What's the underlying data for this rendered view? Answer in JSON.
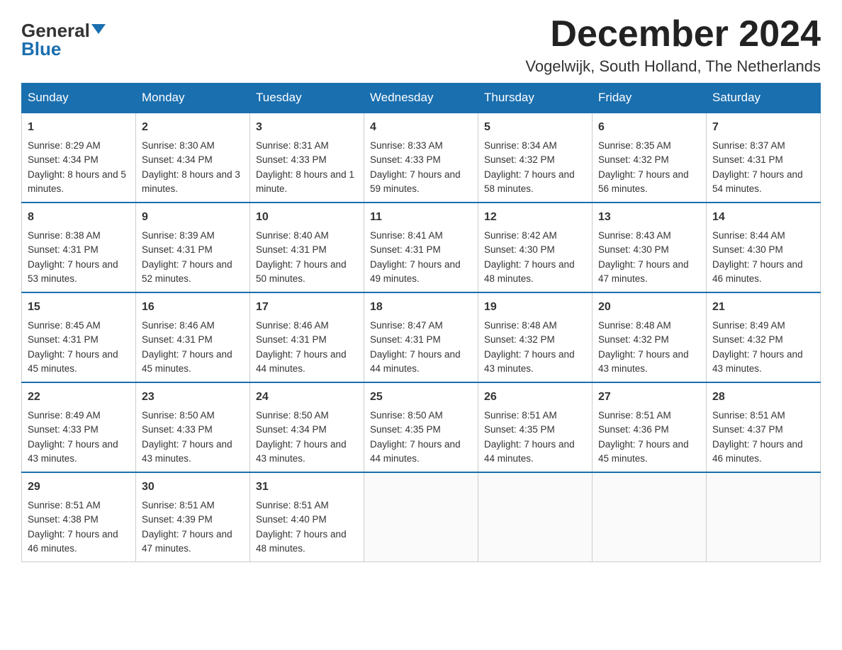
{
  "logo": {
    "general": "General",
    "blue": "Blue"
  },
  "header": {
    "month": "December 2024",
    "location": "Vogelwijk, South Holland, The Netherlands"
  },
  "weekdays": [
    "Sunday",
    "Monday",
    "Tuesday",
    "Wednesday",
    "Thursday",
    "Friday",
    "Saturday"
  ],
  "weeks": [
    [
      {
        "day": "1",
        "sunrise": "Sunrise: 8:29 AM",
        "sunset": "Sunset: 4:34 PM",
        "daylight": "Daylight: 8 hours and 5 minutes."
      },
      {
        "day": "2",
        "sunrise": "Sunrise: 8:30 AM",
        "sunset": "Sunset: 4:34 PM",
        "daylight": "Daylight: 8 hours and 3 minutes."
      },
      {
        "day": "3",
        "sunrise": "Sunrise: 8:31 AM",
        "sunset": "Sunset: 4:33 PM",
        "daylight": "Daylight: 8 hours and 1 minute."
      },
      {
        "day": "4",
        "sunrise": "Sunrise: 8:33 AM",
        "sunset": "Sunset: 4:33 PM",
        "daylight": "Daylight: 7 hours and 59 minutes."
      },
      {
        "day": "5",
        "sunrise": "Sunrise: 8:34 AM",
        "sunset": "Sunset: 4:32 PM",
        "daylight": "Daylight: 7 hours and 58 minutes."
      },
      {
        "day": "6",
        "sunrise": "Sunrise: 8:35 AM",
        "sunset": "Sunset: 4:32 PM",
        "daylight": "Daylight: 7 hours and 56 minutes."
      },
      {
        "day": "7",
        "sunrise": "Sunrise: 8:37 AM",
        "sunset": "Sunset: 4:31 PM",
        "daylight": "Daylight: 7 hours and 54 minutes."
      }
    ],
    [
      {
        "day": "8",
        "sunrise": "Sunrise: 8:38 AM",
        "sunset": "Sunset: 4:31 PM",
        "daylight": "Daylight: 7 hours and 53 minutes."
      },
      {
        "day": "9",
        "sunrise": "Sunrise: 8:39 AM",
        "sunset": "Sunset: 4:31 PM",
        "daylight": "Daylight: 7 hours and 52 minutes."
      },
      {
        "day": "10",
        "sunrise": "Sunrise: 8:40 AM",
        "sunset": "Sunset: 4:31 PM",
        "daylight": "Daylight: 7 hours and 50 minutes."
      },
      {
        "day": "11",
        "sunrise": "Sunrise: 8:41 AM",
        "sunset": "Sunset: 4:31 PM",
        "daylight": "Daylight: 7 hours and 49 minutes."
      },
      {
        "day": "12",
        "sunrise": "Sunrise: 8:42 AM",
        "sunset": "Sunset: 4:30 PM",
        "daylight": "Daylight: 7 hours and 48 minutes."
      },
      {
        "day": "13",
        "sunrise": "Sunrise: 8:43 AM",
        "sunset": "Sunset: 4:30 PM",
        "daylight": "Daylight: 7 hours and 47 minutes."
      },
      {
        "day": "14",
        "sunrise": "Sunrise: 8:44 AM",
        "sunset": "Sunset: 4:30 PM",
        "daylight": "Daylight: 7 hours and 46 minutes."
      }
    ],
    [
      {
        "day": "15",
        "sunrise": "Sunrise: 8:45 AM",
        "sunset": "Sunset: 4:31 PM",
        "daylight": "Daylight: 7 hours and 45 minutes."
      },
      {
        "day": "16",
        "sunrise": "Sunrise: 8:46 AM",
        "sunset": "Sunset: 4:31 PM",
        "daylight": "Daylight: 7 hours and 45 minutes."
      },
      {
        "day": "17",
        "sunrise": "Sunrise: 8:46 AM",
        "sunset": "Sunset: 4:31 PM",
        "daylight": "Daylight: 7 hours and 44 minutes."
      },
      {
        "day": "18",
        "sunrise": "Sunrise: 8:47 AM",
        "sunset": "Sunset: 4:31 PM",
        "daylight": "Daylight: 7 hours and 44 minutes."
      },
      {
        "day": "19",
        "sunrise": "Sunrise: 8:48 AM",
        "sunset": "Sunset: 4:32 PM",
        "daylight": "Daylight: 7 hours and 43 minutes."
      },
      {
        "day": "20",
        "sunrise": "Sunrise: 8:48 AM",
        "sunset": "Sunset: 4:32 PM",
        "daylight": "Daylight: 7 hours and 43 minutes."
      },
      {
        "day": "21",
        "sunrise": "Sunrise: 8:49 AM",
        "sunset": "Sunset: 4:32 PM",
        "daylight": "Daylight: 7 hours and 43 minutes."
      }
    ],
    [
      {
        "day": "22",
        "sunrise": "Sunrise: 8:49 AM",
        "sunset": "Sunset: 4:33 PM",
        "daylight": "Daylight: 7 hours and 43 minutes."
      },
      {
        "day": "23",
        "sunrise": "Sunrise: 8:50 AM",
        "sunset": "Sunset: 4:33 PM",
        "daylight": "Daylight: 7 hours and 43 minutes."
      },
      {
        "day": "24",
        "sunrise": "Sunrise: 8:50 AM",
        "sunset": "Sunset: 4:34 PM",
        "daylight": "Daylight: 7 hours and 43 minutes."
      },
      {
        "day": "25",
        "sunrise": "Sunrise: 8:50 AM",
        "sunset": "Sunset: 4:35 PM",
        "daylight": "Daylight: 7 hours and 44 minutes."
      },
      {
        "day": "26",
        "sunrise": "Sunrise: 8:51 AM",
        "sunset": "Sunset: 4:35 PM",
        "daylight": "Daylight: 7 hours and 44 minutes."
      },
      {
        "day": "27",
        "sunrise": "Sunrise: 8:51 AM",
        "sunset": "Sunset: 4:36 PM",
        "daylight": "Daylight: 7 hours and 45 minutes."
      },
      {
        "day": "28",
        "sunrise": "Sunrise: 8:51 AM",
        "sunset": "Sunset: 4:37 PM",
        "daylight": "Daylight: 7 hours and 46 minutes."
      }
    ],
    [
      {
        "day": "29",
        "sunrise": "Sunrise: 8:51 AM",
        "sunset": "Sunset: 4:38 PM",
        "daylight": "Daylight: 7 hours and 46 minutes."
      },
      {
        "day": "30",
        "sunrise": "Sunrise: 8:51 AM",
        "sunset": "Sunset: 4:39 PM",
        "daylight": "Daylight: 7 hours and 47 minutes."
      },
      {
        "day": "31",
        "sunrise": "Sunrise: 8:51 AM",
        "sunset": "Sunset: 4:40 PM",
        "daylight": "Daylight: 7 hours and 48 minutes."
      },
      null,
      null,
      null,
      null
    ]
  ]
}
